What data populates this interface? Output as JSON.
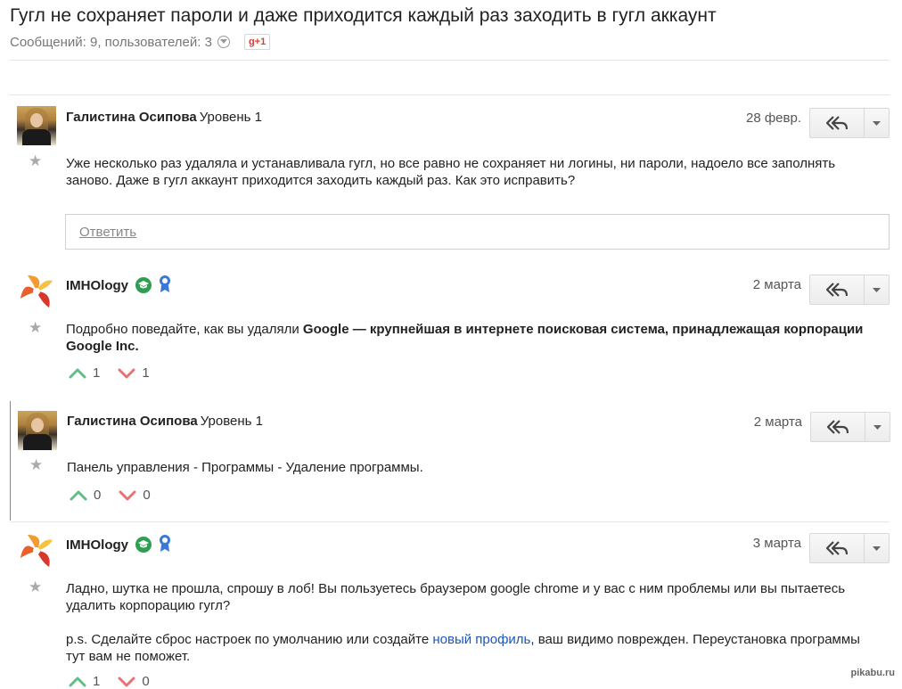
{
  "thread": {
    "title": "Гугл не сохраняет пароли и даже приходится каждый раз заходить в гугл аккаунт",
    "meta": "Сообщений: 9, пользователей: 3",
    "gplus_label": "g+1"
  },
  "reply_box": {
    "placeholder_link": "Ответить"
  },
  "posts": [
    {
      "author": "Галистина Осипова",
      "level": "Уровень 1",
      "date": "28 февр.",
      "body": "Уже несколько раз удаляла и устанавливала гугл, но все равно не сохраняет ни логины, ни пароли, надоело все заполнять заново. Даже в гугл аккаунт приходится заходить каждый раз. Как это исправить?"
    },
    {
      "author": "IMHOlogy",
      "date": "2 марта",
      "body_prefix": "Подробно поведайте, как вы удаляли ",
      "body_bold": "Google — крупнейшая в интернете поисковая система, принадлежащая корпорации Google Inc.",
      "upvotes": "1",
      "downvotes": "1"
    },
    {
      "author": "Галистина Осипова",
      "level": "Уровень 1",
      "date": "2 марта",
      "body": "Панель управления - Программы - Удаление программы.",
      "upvotes": "0",
      "downvotes": "0"
    },
    {
      "author": "IMHOlogy",
      "date": "3 марта",
      "body_p1": "Ладно, шутка не прошла, спрошу в лоб! Вы пользуетесь браузером google chrome и у вас с ним проблемы или вы пытаетесь удалить корпорацию гугл?",
      "body_p2_prefix": "p.s. Сделайте сброс настроек по умолчанию или создайте ",
      "body_p2_link": "новый профиль",
      "body_p2_suffix": ", ваш видимо поврежден. Переустановка программы тут вам не поможет.",
      "upvotes": "1",
      "downvotes": "0"
    }
  ],
  "watermark": "pikabu.ru",
  "colors": {
    "upvote": "#5fbf85",
    "downvote": "#e57373",
    "link": "#1a56c0",
    "highlight_border": "#4caf50"
  }
}
